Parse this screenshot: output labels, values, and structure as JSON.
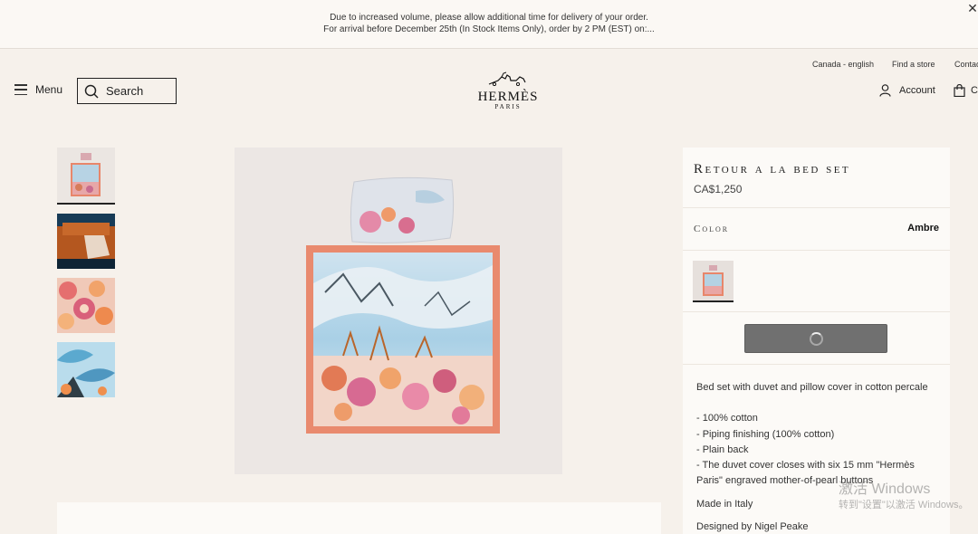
{
  "banner": {
    "line1": "Due to increased volume, please allow additional time for delivery of your order.",
    "line2": "For arrival before December 25th (In Stock Items Only), order by 2 PM (EST) on:...",
    "close_glyph": "✕"
  },
  "utility": {
    "region": "Canada - english",
    "find_store": "Find a store",
    "contact": "Contac"
  },
  "header": {
    "menu_label": "Menu",
    "search_label": "Search",
    "logo_name": "HERMÈS",
    "logo_city": "PARIS",
    "account_label": "Account",
    "cart_letter": "C"
  },
  "gallery": {
    "thumbnails": [
      "bed-set-front-view",
      "bed-set-on-sofa",
      "floral-detail",
      "leaf-detail"
    ],
    "active_index": 0
  },
  "product": {
    "title": "Retour a la bed set",
    "price": "CA$1,250",
    "color_label": "Color",
    "color_value": "Ambre",
    "description": [
      "Bed set with duvet and pillow cover in cotton percale",
      "",
      "- 100% cotton",
      "- Piping finishing (100% cotton)",
      "- Plain back",
      "- The duvet cover closes with six 15 mm \"Hermès Paris\" engraved mother-of-pearl buttons",
      "Made in Italy",
      "Designed by Nigel Peake"
    ]
  },
  "watermark": {
    "line1": "激活 Windows",
    "line2": "转到\"设置\"以激活 Windows。"
  },
  "colors": {
    "background": "#f6f1eb",
    "panel": "#fcfaf7",
    "button": "#707070",
    "border_accent": "#e8866a"
  },
  "icons": [
    "hamburger-icon",
    "search-icon",
    "user-icon",
    "shopping-bag-icon",
    "close-icon",
    "loading-spinner-icon"
  ]
}
